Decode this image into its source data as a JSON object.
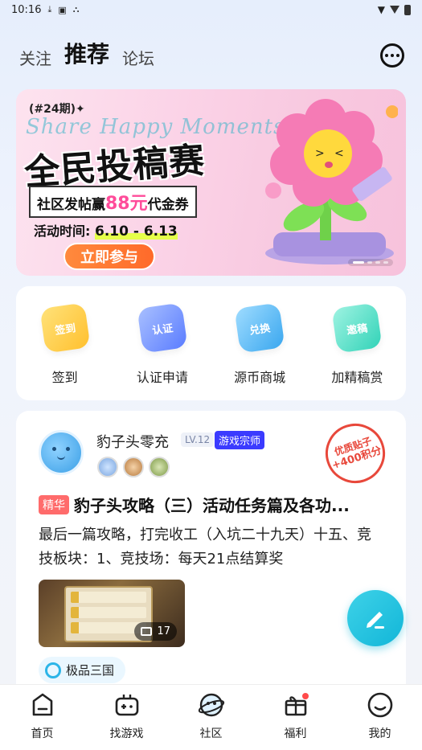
{
  "status_bar": {
    "time": "10:16"
  },
  "top_tabs": [
    {
      "label": "关注",
      "active": false
    },
    {
      "label": "推荐",
      "active": true
    },
    {
      "label": "论坛",
      "active": false
    }
  ],
  "banner": {
    "issue": "(#24期)✦",
    "script_text": "Share Happy Moments",
    "title": "全民投稿赛",
    "subtitle_pre": "社区发帖赢",
    "subtitle_amount": "88元",
    "subtitle_post": "代金券",
    "time_label": "活动时间:",
    "time_range": "6.10 - 6.13",
    "cta": "立即参与"
  },
  "quick_actions": [
    {
      "label": "签到",
      "icon_text": "签到",
      "color": "#ffcf3a"
    },
    {
      "label": "认证申请",
      "icon_text": "认证",
      "color": "#6a8cff"
    },
    {
      "label": "源币商城",
      "icon_text": "兑换",
      "color": "#45b6f2"
    },
    {
      "label": "加精稿赏",
      "icon_text": "邀稿",
      "color": "#3fd8c0"
    }
  ],
  "post": {
    "username": "豹子头零充",
    "level": "LV.12",
    "user_title": "游戏宗师",
    "stamp_line1": "优质贴子",
    "stamp_line2": "+400积分",
    "tag": "精华",
    "title": "豹子头攻略（三）活动任务篇及各功...",
    "body": "最后一篇攻略，打完收工（入坑二十九天）十五、竞技板块：1、竞技场：每天21点结算奖",
    "image_count": "17",
    "topic": "极品三国"
  },
  "bottom_nav": [
    {
      "label": "首页"
    },
    {
      "label": "找游戏"
    },
    {
      "label": "社区",
      "active": true
    },
    {
      "label": "福利"
    },
    {
      "label": "我的"
    }
  ]
}
